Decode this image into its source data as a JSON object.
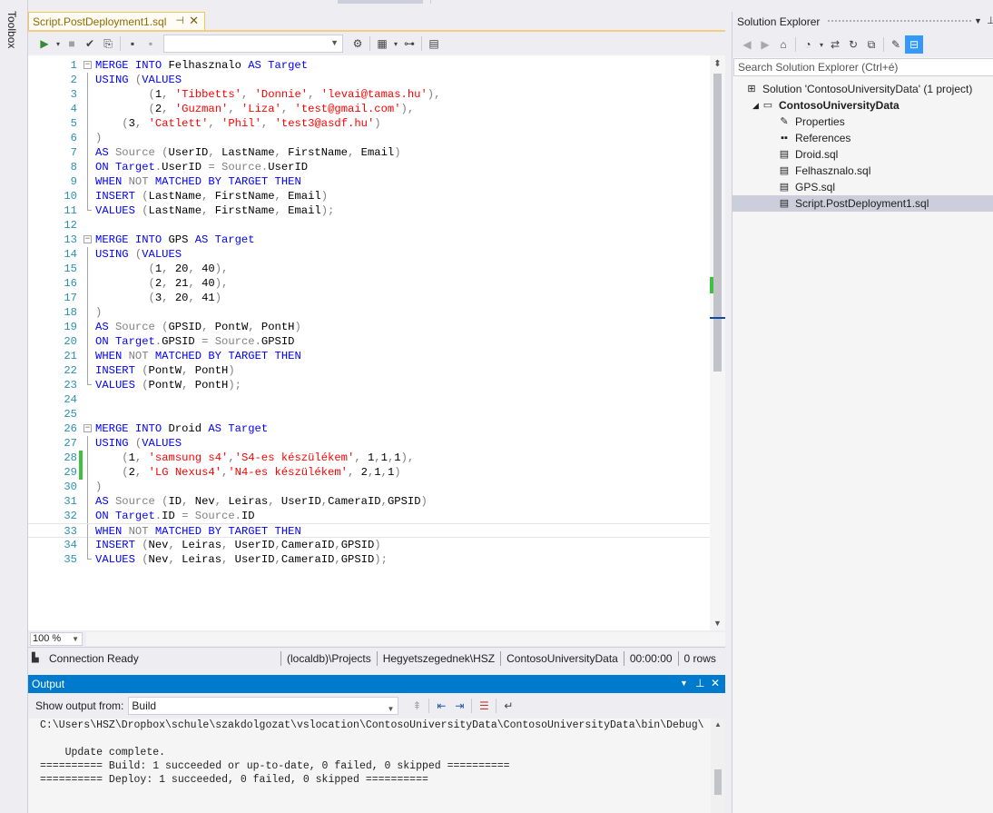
{
  "toolbox": {
    "label": "Toolbox"
  },
  "document_tab": {
    "title": "Script.PostDeployment1.sql",
    "pin": "⊣",
    "close": "✕"
  },
  "editor_toolbar": {
    "db_dropdown_value": ""
  },
  "code_lines": [
    {
      "n": "1",
      "fold": "open",
      "tokens": [
        [
          "kw",
          "MERGE INTO "
        ],
        [
          "tx",
          "Felhasznalo "
        ],
        [
          "kw",
          "AS "
        ],
        [
          "kw",
          "Target"
        ]
      ]
    },
    {
      "n": "2",
      "fold": "line",
      "tokens": [
        [
          "kw",
          "USING "
        ],
        [
          "gr",
          "("
        ],
        [
          "kw",
          "VALUES"
        ]
      ]
    },
    {
      "n": "3",
      "fold": "line",
      "tokens": [
        [
          "tx",
          "        "
        ],
        [
          "gr",
          "("
        ],
        [
          "tx",
          "1"
        ],
        [
          "gr",
          ", "
        ],
        [
          "st",
          "'Tibbetts'"
        ],
        [
          "gr",
          ", "
        ],
        [
          "st",
          "'Donnie'"
        ],
        [
          "gr",
          ", "
        ],
        [
          "st",
          "'levai@tamas.hu'"
        ],
        [
          "gr",
          "),"
        ]
      ]
    },
    {
      "n": "4",
      "fold": "line",
      "tokens": [
        [
          "tx",
          "        "
        ],
        [
          "gr",
          "("
        ],
        [
          "tx",
          "2"
        ],
        [
          "gr",
          ", "
        ],
        [
          "st",
          "'Guzman'"
        ],
        [
          "gr",
          ", "
        ],
        [
          "st",
          "'Liza'"
        ],
        [
          "gr",
          ", "
        ],
        [
          "st",
          "'test@gmail.com'"
        ],
        [
          "gr",
          "),"
        ]
      ]
    },
    {
      "n": "5",
      "fold": "line",
      "tokens": [
        [
          "tx",
          "    "
        ],
        [
          "gr",
          "("
        ],
        [
          "tx",
          "3"
        ],
        [
          "gr",
          ", "
        ],
        [
          "st",
          "'Catlett'"
        ],
        [
          "gr",
          ", "
        ],
        [
          "st",
          "'Phil'"
        ],
        [
          "gr",
          ", "
        ],
        [
          "st",
          "'test3@asdf.hu'"
        ],
        [
          "gr",
          ")"
        ]
      ]
    },
    {
      "n": "6",
      "fold": "line",
      "tokens": [
        [
          "gr",
          ")"
        ]
      ]
    },
    {
      "n": "7",
      "fold": "line",
      "tokens": [
        [
          "kw",
          "AS "
        ],
        [
          "gr",
          "Source "
        ],
        [
          "gr",
          "("
        ],
        [
          "tx",
          "UserID"
        ],
        [
          "gr",
          ", "
        ],
        [
          "tx",
          "LastName"
        ],
        [
          "gr",
          ", "
        ],
        [
          "tx",
          "FirstName"
        ],
        [
          "gr",
          ", "
        ],
        [
          "tx",
          "Email"
        ],
        [
          "gr",
          ")"
        ]
      ]
    },
    {
      "n": "8",
      "fold": "line",
      "tokens": [
        [
          "kw",
          "ON "
        ],
        [
          "kw",
          "Target"
        ],
        [
          "gr",
          "."
        ],
        [
          "tx",
          "UserID "
        ],
        [
          "gr",
          "= "
        ],
        [
          "gr",
          "Source"
        ],
        [
          "gr",
          "."
        ],
        [
          "tx",
          "UserID"
        ]
      ]
    },
    {
      "n": "9",
      "fold": "line",
      "tokens": [
        [
          "kw",
          "WHEN "
        ],
        [
          "gr",
          "NOT "
        ],
        [
          "kw",
          "MATCHED "
        ],
        [
          "kw",
          "BY "
        ],
        [
          "kw",
          "TARGET "
        ],
        [
          "kw",
          "THEN"
        ]
      ]
    },
    {
      "n": "10",
      "fold": "line",
      "tokens": [
        [
          "kw",
          "INSERT "
        ],
        [
          "gr",
          "("
        ],
        [
          "tx",
          "LastName"
        ],
        [
          "gr",
          ", "
        ],
        [
          "tx",
          "FirstName"
        ],
        [
          "gr",
          ", "
        ],
        [
          "tx",
          "Email"
        ],
        [
          "gr",
          ")"
        ]
      ]
    },
    {
      "n": "11",
      "fold": "end",
      "tokens": [
        [
          "kw",
          "VALUES "
        ],
        [
          "gr",
          "("
        ],
        [
          "tx",
          "LastName"
        ],
        [
          "gr",
          ", "
        ],
        [
          "tx",
          "FirstName"
        ],
        [
          "gr",
          ", "
        ],
        [
          "tx",
          "Email"
        ],
        [
          "gr",
          ");"
        ]
      ]
    },
    {
      "n": "12",
      "fold": "none",
      "tokens": []
    },
    {
      "n": "13",
      "fold": "open",
      "tokens": [
        [
          "kw",
          "MERGE INTO "
        ],
        [
          "tx",
          "GPS "
        ],
        [
          "kw",
          "AS "
        ],
        [
          "kw",
          "Target"
        ]
      ]
    },
    {
      "n": "14",
      "fold": "line",
      "tokens": [
        [
          "kw",
          "USING "
        ],
        [
          "gr",
          "("
        ],
        [
          "kw",
          "VALUES"
        ]
      ]
    },
    {
      "n": "15",
      "fold": "line",
      "tokens": [
        [
          "tx",
          "        "
        ],
        [
          "gr",
          "("
        ],
        [
          "tx",
          "1"
        ],
        [
          "gr",
          ", "
        ],
        [
          "tx",
          "20"
        ],
        [
          "gr",
          ", "
        ],
        [
          "tx",
          "40"
        ],
        [
          "gr",
          "),"
        ]
      ]
    },
    {
      "n": "16",
      "fold": "line",
      "tokens": [
        [
          "tx",
          "        "
        ],
        [
          "gr",
          "("
        ],
        [
          "tx",
          "2"
        ],
        [
          "gr",
          ", "
        ],
        [
          "tx",
          "21"
        ],
        [
          "gr",
          ", "
        ],
        [
          "tx",
          "40"
        ],
        [
          "gr",
          "),"
        ]
      ]
    },
    {
      "n": "17",
      "fold": "line",
      "tokens": [
        [
          "tx",
          "        "
        ],
        [
          "gr",
          "("
        ],
        [
          "tx",
          "3"
        ],
        [
          "gr",
          ", "
        ],
        [
          "tx",
          "20"
        ],
        [
          "gr",
          ", "
        ],
        [
          "tx",
          "41"
        ],
        [
          "gr",
          ")"
        ]
      ]
    },
    {
      "n": "18",
      "fold": "line",
      "tokens": [
        [
          "gr",
          ")"
        ]
      ]
    },
    {
      "n": "19",
      "fold": "line",
      "tokens": [
        [
          "kw",
          "AS "
        ],
        [
          "gr",
          "Source "
        ],
        [
          "gr",
          "("
        ],
        [
          "tx",
          "GPSID"
        ],
        [
          "gr",
          ", "
        ],
        [
          "tx",
          "PontW"
        ],
        [
          "gr",
          ", "
        ],
        [
          "tx",
          "PontH"
        ],
        [
          "gr",
          ")"
        ]
      ]
    },
    {
      "n": "20",
      "fold": "line",
      "tokens": [
        [
          "kw",
          "ON "
        ],
        [
          "kw",
          "Target"
        ],
        [
          "gr",
          "."
        ],
        [
          "tx",
          "GPSID "
        ],
        [
          "gr",
          "= "
        ],
        [
          "gr",
          "Source"
        ],
        [
          "gr",
          "."
        ],
        [
          "tx",
          "GPSID"
        ]
      ]
    },
    {
      "n": "21",
      "fold": "line",
      "tokens": [
        [
          "kw",
          "WHEN "
        ],
        [
          "gr",
          "NOT "
        ],
        [
          "kw",
          "MATCHED "
        ],
        [
          "kw",
          "BY "
        ],
        [
          "kw",
          "TARGET "
        ],
        [
          "kw",
          "THEN"
        ]
      ]
    },
    {
      "n": "22",
      "fold": "line",
      "tokens": [
        [
          "kw",
          "INSERT "
        ],
        [
          "gr",
          "("
        ],
        [
          "tx",
          "PontW"
        ],
        [
          "gr",
          ", "
        ],
        [
          "tx",
          "PontH"
        ],
        [
          "gr",
          ")"
        ]
      ]
    },
    {
      "n": "23",
      "fold": "end",
      "tokens": [
        [
          "kw",
          "VALUES "
        ],
        [
          "gr",
          "("
        ],
        [
          "tx",
          "PontW"
        ],
        [
          "gr",
          ", "
        ],
        [
          "tx",
          "PontH"
        ],
        [
          "gr",
          ");"
        ]
      ]
    },
    {
      "n": "24",
      "fold": "none",
      "tokens": []
    },
    {
      "n": "25",
      "fold": "none",
      "tokens": []
    },
    {
      "n": "26",
      "fold": "open",
      "tokens": [
        [
          "kw",
          "MERGE INTO "
        ],
        [
          "tx",
          "Droid "
        ],
        [
          "kw",
          "AS "
        ],
        [
          "kw",
          "Target"
        ]
      ]
    },
    {
      "n": "27",
      "fold": "line",
      "tokens": [
        [
          "kw",
          "USING "
        ],
        [
          "gr",
          "("
        ],
        [
          "kw",
          "VALUES"
        ]
      ]
    },
    {
      "n": "28",
      "fold": "line",
      "changed": true,
      "tokens": [
        [
          "tx",
          "    "
        ],
        [
          "gr",
          "("
        ],
        [
          "tx",
          "1"
        ],
        [
          "gr",
          ", "
        ],
        [
          "st",
          "'samsung s4'"
        ],
        [
          "gr",
          ","
        ],
        [
          "st",
          "'S4-es készülékem'"
        ],
        [
          "gr",
          ", "
        ],
        [
          "tx",
          "1"
        ],
        [
          "gr",
          ","
        ],
        [
          "tx",
          "1"
        ],
        [
          "gr",
          ","
        ],
        [
          "tx",
          "1"
        ],
        [
          "gr",
          "),"
        ]
      ]
    },
    {
      "n": "29",
      "fold": "line",
      "changed": true,
      "tokens": [
        [
          "tx",
          "    "
        ],
        [
          "gr",
          "("
        ],
        [
          "tx",
          "2"
        ],
        [
          "gr",
          ", "
        ],
        [
          "st",
          "'LG Nexus4'"
        ],
        [
          "gr",
          ","
        ],
        [
          "st",
          "'N4-es készülékem'"
        ],
        [
          "gr",
          ", "
        ],
        [
          "tx",
          "2"
        ],
        [
          "gr",
          ","
        ],
        [
          "tx",
          "1"
        ],
        [
          "gr",
          ","
        ],
        [
          "tx",
          "1"
        ],
        [
          "gr",
          ")"
        ]
      ]
    },
    {
      "n": "30",
      "fold": "line",
      "tokens": [
        [
          "gr",
          ")"
        ]
      ]
    },
    {
      "n": "31",
      "fold": "line",
      "tokens": [
        [
          "kw",
          "AS "
        ],
        [
          "gr",
          "Source "
        ],
        [
          "gr",
          "("
        ],
        [
          "tx",
          "ID"
        ],
        [
          "gr",
          ", "
        ],
        [
          "tx",
          "Nev"
        ],
        [
          "gr",
          ", "
        ],
        [
          "tx",
          "Leiras"
        ],
        [
          "gr",
          ", "
        ],
        [
          "tx",
          "UserID"
        ],
        [
          "gr",
          ","
        ],
        [
          "tx",
          "CameraID"
        ],
        [
          "gr",
          ","
        ],
        [
          "tx",
          "GPSID"
        ],
        [
          "gr",
          ")"
        ]
      ]
    },
    {
      "n": "32",
      "fold": "line",
      "tokens": [
        [
          "kw",
          "ON "
        ],
        [
          "kw",
          "Target"
        ],
        [
          "gr",
          "."
        ],
        [
          "tx",
          "ID "
        ],
        [
          "gr",
          "= "
        ],
        [
          "gr",
          "Source"
        ],
        [
          "gr",
          "."
        ],
        [
          "tx",
          "ID"
        ]
      ]
    },
    {
      "n": "33",
      "fold": "line",
      "current": true,
      "tokens": [
        [
          "kw",
          "WHEN "
        ],
        [
          "gr",
          "NOT "
        ],
        [
          "kw",
          "MATCHED "
        ],
        [
          "kw",
          "BY "
        ],
        [
          "kw",
          "TARGET "
        ],
        [
          "kw",
          "THEN"
        ]
      ]
    },
    {
      "n": "34",
      "fold": "line",
      "tokens": [
        [
          "kw",
          "INSERT "
        ],
        [
          "gr",
          "("
        ],
        [
          "tx",
          "Nev"
        ],
        [
          "gr",
          ", "
        ],
        [
          "tx",
          "Leiras"
        ],
        [
          "gr",
          ", "
        ],
        [
          "tx",
          "UserID"
        ],
        [
          "gr",
          ","
        ],
        [
          "tx",
          "CameraID"
        ],
        [
          "gr",
          ","
        ],
        [
          "tx",
          "GPSID"
        ],
        [
          "gr",
          ")"
        ]
      ]
    },
    {
      "n": "35",
      "fold": "end",
      "tokens": [
        [
          "kw",
          "VALUES "
        ],
        [
          "gr",
          "("
        ],
        [
          "tx",
          "Nev"
        ],
        [
          "gr",
          ", "
        ],
        [
          "tx",
          "Leiras"
        ],
        [
          "gr",
          ", "
        ],
        [
          "tx",
          "UserID"
        ],
        [
          "gr",
          ","
        ],
        [
          "tx",
          "CameraID"
        ],
        [
          "gr",
          ","
        ],
        [
          "tx",
          "GPSID"
        ],
        [
          "gr",
          ");"
        ]
      ]
    }
  ],
  "zoom": {
    "value": "100 %"
  },
  "connection_bar": {
    "status": "Connection Ready",
    "server": "(localdb)\\Projects",
    "user": "Hegyetszegednek\\HSZ",
    "database": "ContosoUniversityData",
    "elapsed": "00:00:00",
    "rows": "0 rows"
  },
  "output": {
    "title": "Output",
    "show_from_label": "Show output from:",
    "source": "Build",
    "lines": [
      "C:\\Users\\HSZ\\Dropbox\\schule\\szakdolgozat\\vslocation\\ContosoUniversityData\\ContosoUniversityData\\bin\\Debug\\",
      "",
      "    Update complete.",
      "========== Build: 1 succeeded or up-to-date, 0 failed, 0 skipped ==========",
      "========== Deploy: 1 succeeded, 0 failed, 0 skipped =========="
    ]
  },
  "solution_explorer": {
    "title": "Solution Explorer",
    "search_placeholder": "Search Solution Explorer (Ctrl+é)",
    "tree": [
      {
        "label": "Solution 'ContosoUniversityData' (1 project)",
        "icon": "solution-icon",
        "indent": 0,
        "arrow": "",
        "bold": false,
        "selected": false
      },
      {
        "label": "ContosoUniversityData",
        "icon": "project-icon",
        "indent": 1,
        "arrow": "◢",
        "bold": true,
        "selected": false
      },
      {
        "label": "Properties",
        "icon": "wrench-icon",
        "indent": 2,
        "arrow": "",
        "bold": false,
        "selected": false
      },
      {
        "label": "References",
        "icon": "references-icon",
        "indent": 2,
        "arrow": "",
        "bold": false,
        "selected": false
      },
      {
        "label": "Droid.sql",
        "icon": "sql-file-icon",
        "indent": 2,
        "arrow": "",
        "bold": false,
        "selected": false
      },
      {
        "label": "Felhasznalo.sql",
        "icon": "sql-file-icon",
        "indent": 2,
        "arrow": "",
        "bold": false,
        "selected": false
      },
      {
        "label": "GPS.sql",
        "icon": "sql-file-icon",
        "indent": 2,
        "arrow": "",
        "bold": false,
        "selected": false
      },
      {
        "label": "Script.PostDeployment1.sql",
        "icon": "sql-file-icon",
        "indent": 2,
        "arrow": "",
        "bold": false,
        "selected": true
      }
    ]
  },
  "colors": {
    "accent": "#007acc",
    "tab_border": "#f0c850",
    "keyword": "#0000ff",
    "string": "#ff0000",
    "line_number": "#2b91af",
    "change_marker": "#40c040"
  }
}
